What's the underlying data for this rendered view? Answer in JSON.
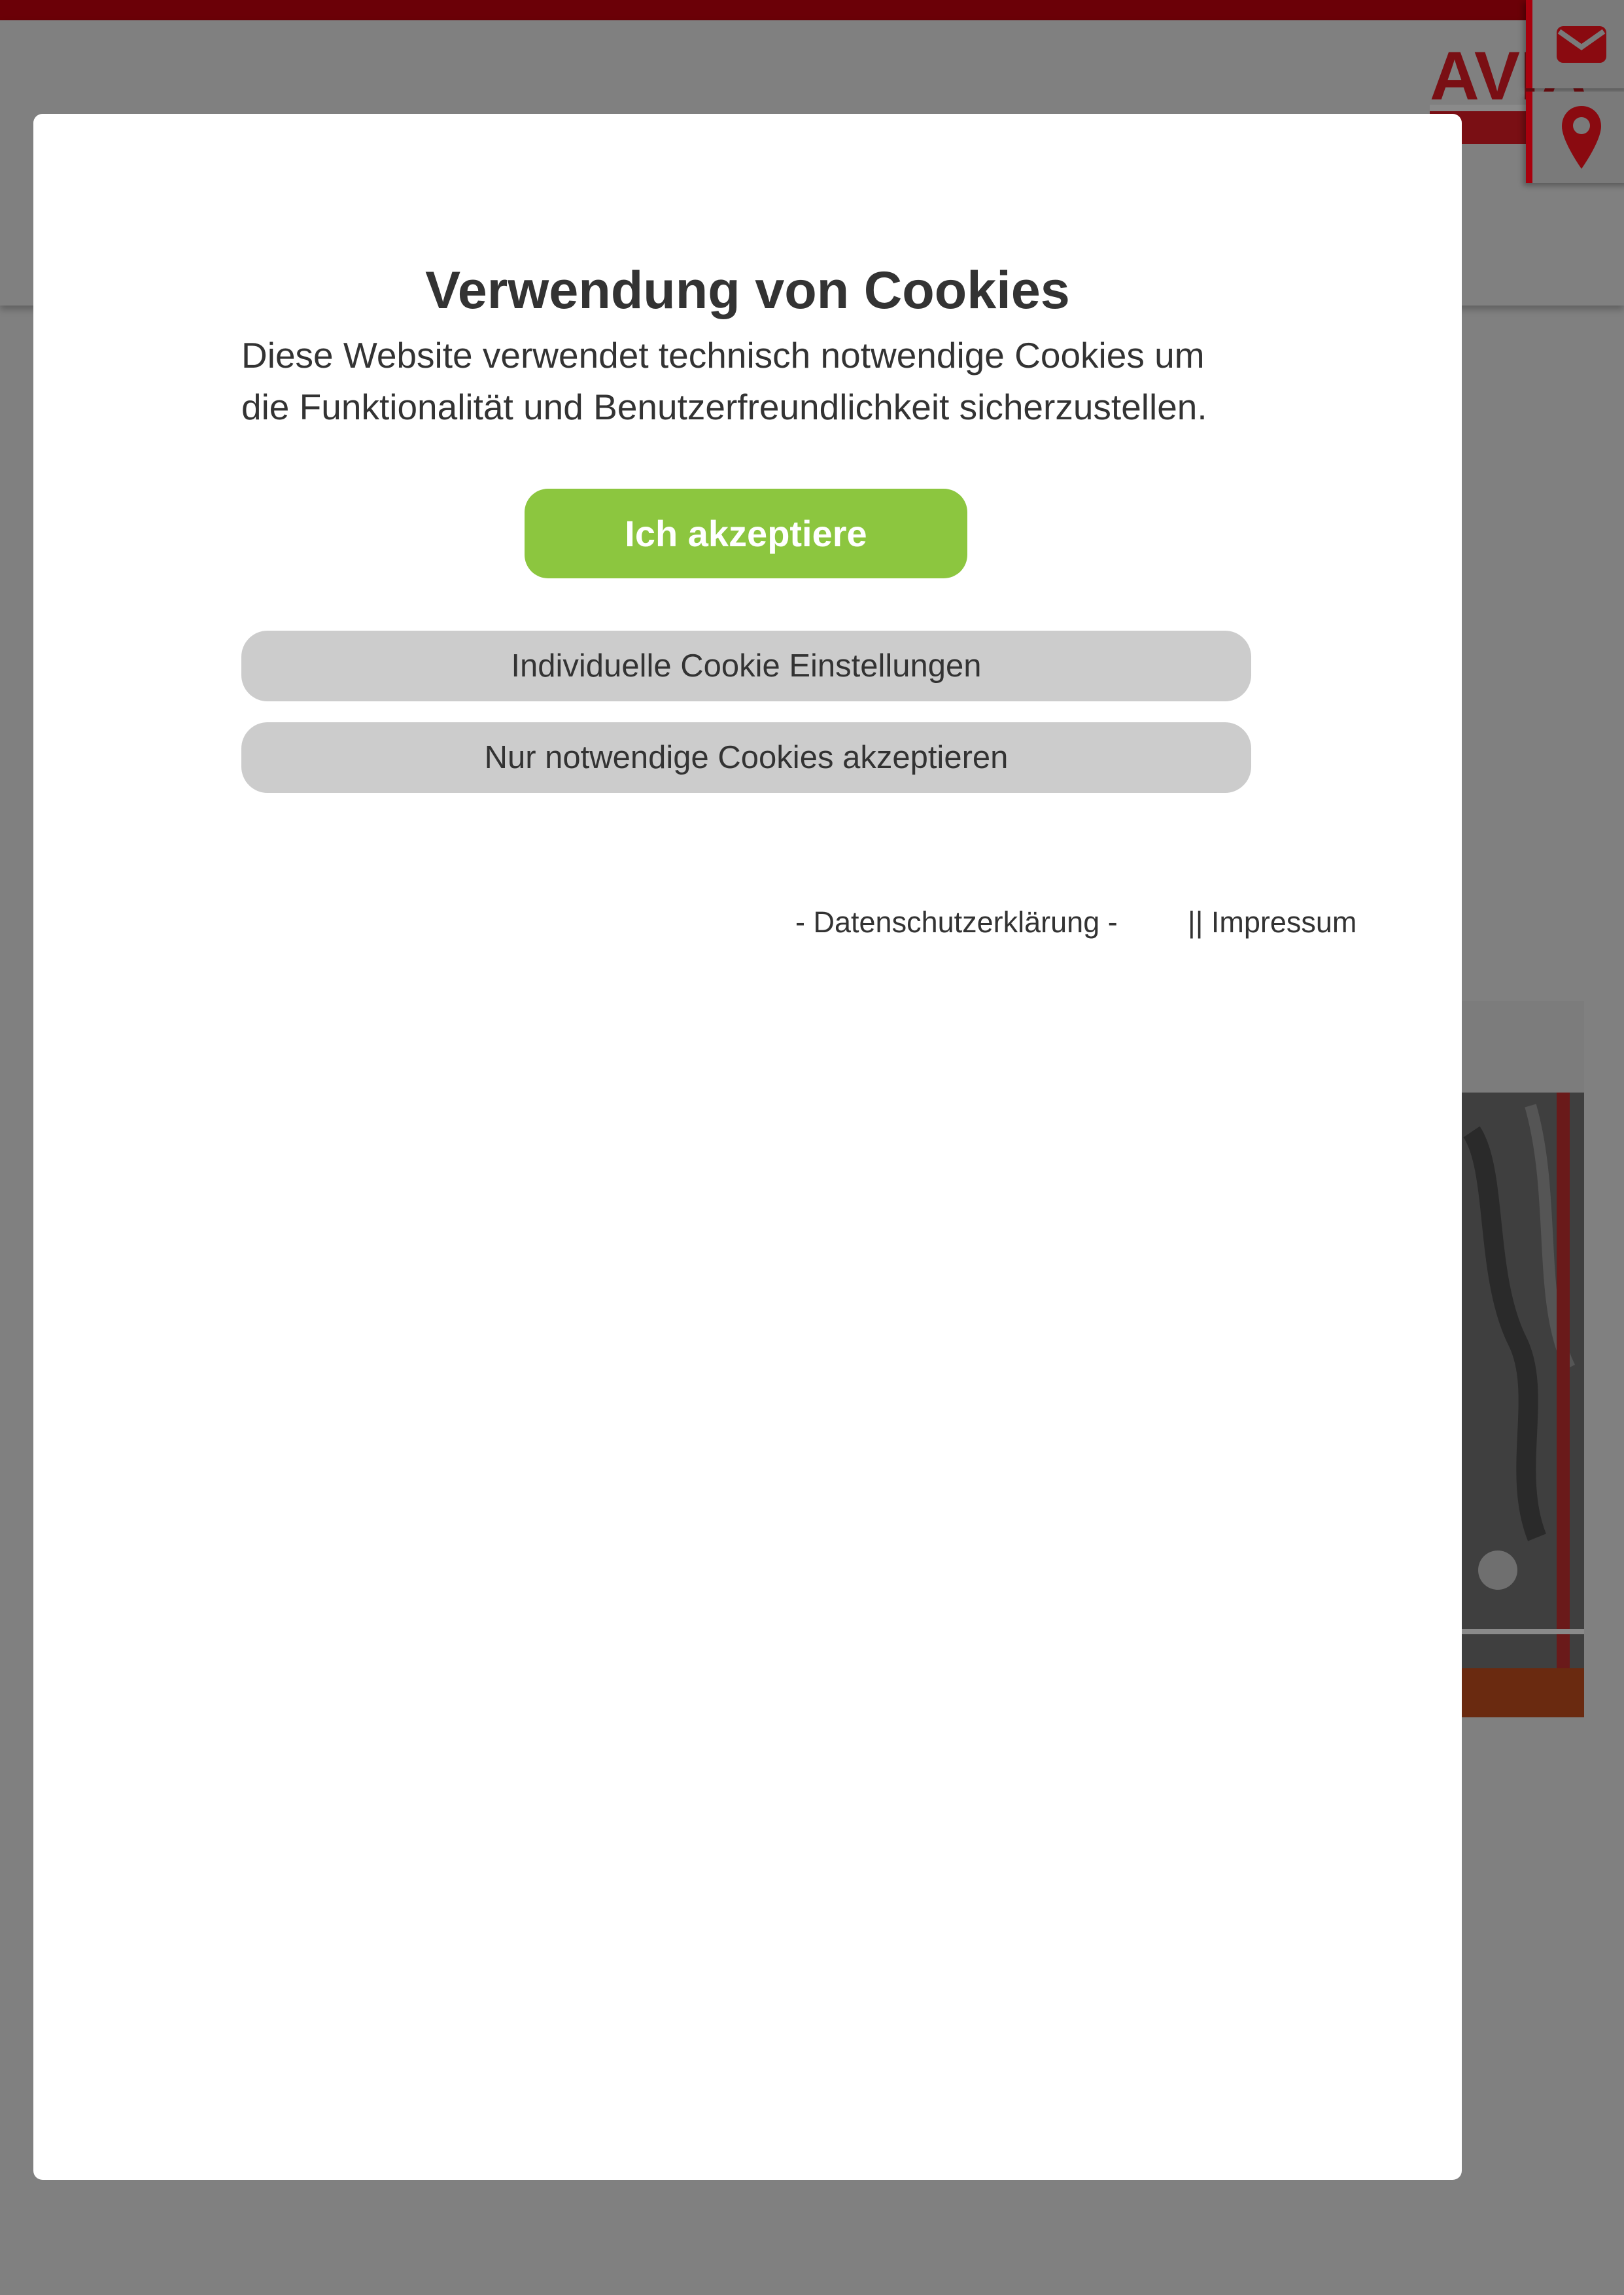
{
  "page": {
    "background_color": "#808080",
    "top_bar_color": "#6b0007",
    "brand_color": "#a8000d"
  },
  "header": {
    "logo_icon": "avia-logo",
    "mail_icon": "envelope-icon",
    "location_icon": "map-pin-icon"
  },
  "cookie_dialog": {
    "title": "Verwendung von Cookies",
    "text_line_1": "Diese Website verwendet technisch notwendige Cookies um",
    "text_line_2": "die Funktionalität und Benutzerfreundlichkeit sicherzustellen.",
    "accept_label": "Ich akzeptiere",
    "accept_color": "#8cc63f",
    "individual_settings_label": "Individuelle Cookie Einstellungen",
    "only_necessary_label": "Nur notwendige Cookies akzeptieren",
    "privacy_link": "- Datenschutzerklärung -",
    "imprint_link": "|| Impressum"
  }
}
